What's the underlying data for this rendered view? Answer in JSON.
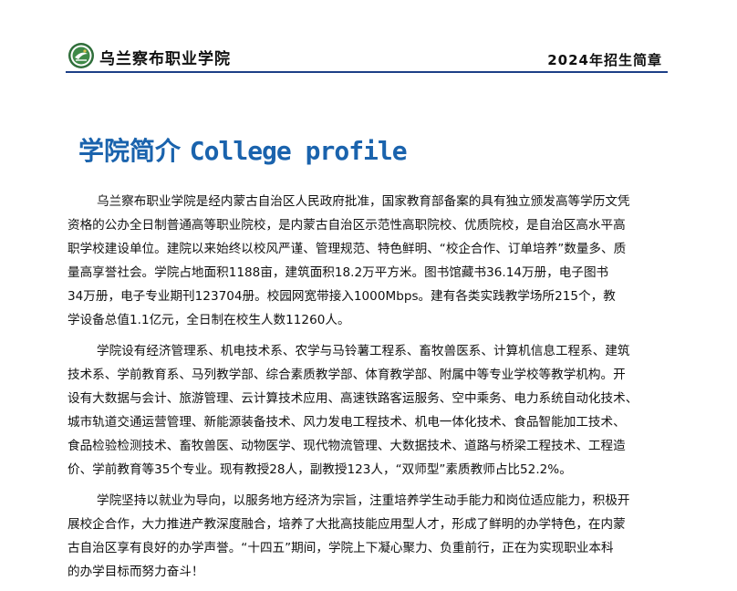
{
  "header": {
    "school_name": "乌兰察布职业学院",
    "brochure_title": "2024年招生简章",
    "accent_color": "#1c3f87",
    "logo_icon": "school-emblem-icon"
  },
  "section": {
    "title_cn": "学院简介",
    "title_en": "College profile",
    "title_color": "#1a63ad"
  },
  "paragraphs": [
    {
      "lines": [
        "乌兰察布职业学院是经内蒙古自治区人民政府批准，国家教育部备案的具有独立颁发高等学历文凭",
        "资格的公办全日制普通高等职业院校，是内蒙古自治区示范性高职院校、优质院校，是自治区高水平高",
        "职学校建设单位。建院以来始终以校风严谨、管理规范、特色鲜明、“校企合作、订单培养”数量多、质",
        "量高享誉社会。学院占地面积1188亩，建筑面积18.2万平方米。图书馆藏书36.14万册，电子图书",
        "34万册，电子专业期刊123704册。校园网宽带接入1000Mbps。建有各类实践教学场所215个，教",
        "学设备总值1.1亿元，全日制在校生人数11260人。"
      ]
    },
    {
      "lines": [
        "学院设有经济管理系、机电技术系、农学与马铃薯工程系、畜牧兽医系、计算机信息工程系、建筑",
        "技术系、学前教育系、马列教学部、综合素质教学部、体育教学部、附属中等专业学校等教学机构。开",
        "设有大数据与会计、旅游管理、云计算技术应用、高速铁路客运服务、空中乘务、电力系统自动化技术、",
        "城市轨道交通运营管理、新能源装备技术、风力发电工程技术、机电一体化技术、食品智能加工技术、",
        "食品检验检测技术、畜牧兽医、动物医学、现代物流管理、大数据技术、道路与桥梁工程技术、工程造",
        "价、学前教育等35个专业。现有教授28人，副教授123人，“双师型”素质教师占比52.2%。"
      ]
    },
    {
      "lines": [
        "学院坚持以就业为导向，以服务地方经济为宗旨，注重培养学生动手能力和岗位适应能力，积极开",
        "展校企合作，大力推进产教深度融合，培养了大批高技能应用型人才，形成了鲜明的办学特色，在内蒙",
        "古自治区享有良好的办学声誉。“十四五”期间，学院上下凝心聚力、负重前行，正在为实现职业本科",
        "的办学目标而努力奋斗！"
      ]
    }
  ]
}
